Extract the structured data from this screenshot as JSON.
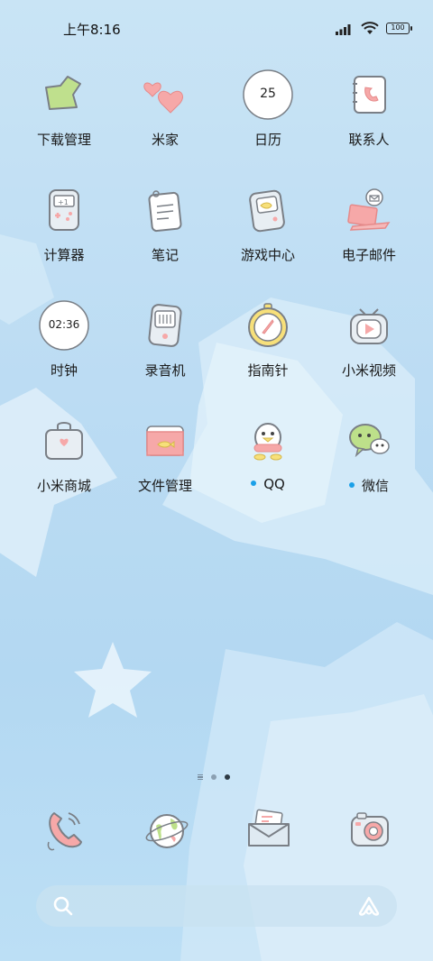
{
  "status_bar": {
    "time": "上午8:16",
    "battery_level": "100",
    "signal_icon": "signal-icon",
    "wifi_icon": "wifi-icon"
  },
  "apps": [
    {
      "label": "下载管理",
      "icon": "download-manager-icon",
      "badge_dot": false
    },
    {
      "label": "米家",
      "icon": "mijia-hearts-icon",
      "badge_dot": false
    },
    {
      "label": "日历",
      "icon": "calendar-icon",
      "date_number": "25",
      "badge_dot": false
    },
    {
      "label": "联系人",
      "icon": "contacts-icon",
      "badge_dot": false
    },
    {
      "label": "计算器",
      "icon": "calculator-icon",
      "badge_dot": false
    },
    {
      "label": "笔记",
      "icon": "notes-icon",
      "badge_dot": false
    },
    {
      "label": "游戏中心",
      "icon": "game-center-icon",
      "badge_dot": false
    },
    {
      "label": "电子邮件",
      "icon": "email-laptop-icon",
      "badge_dot": false
    },
    {
      "label": "时钟",
      "icon": "clock-icon",
      "clock_time": "02:36",
      "badge_dot": false
    },
    {
      "label": "录音机",
      "icon": "recorder-icon",
      "badge_dot": false
    },
    {
      "label": "指南针",
      "icon": "compass-icon",
      "badge_dot": false
    },
    {
      "label": "小米视频",
      "icon": "video-tv-icon",
      "badge_dot": false
    },
    {
      "label": "小米商城",
      "icon": "shopping-bag-icon",
      "badge_dot": false
    },
    {
      "label": "文件管理",
      "icon": "file-folder-icon",
      "badge_dot": false
    },
    {
      "label": "QQ",
      "icon": "qq-penguin-icon",
      "badge_dot": true
    },
    {
      "label": "微信",
      "icon": "wechat-icon",
      "badge_dot": true
    }
  ],
  "page_indicator": {
    "pages": 2,
    "active_index": 1
  },
  "dock": [
    {
      "icon": "phone-icon"
    },
    {
      "icon": "browser-globe-icon"
    },
    {
      "icon": "messages-envelope-icon"
    },
    {
      "icon": "camera-icon"
    }
  ],
  "search_bar": {
    "placeholder": "",
    "search_icon": "search-icon",
    "assistant_icon": "assistant-icon"
  },
  "colors": {
    "background_top": "#c9e4f5",
    "background_bottom": "#bcdff5",
    "badge_dot": "#1aa0e8",
    "icon_outline": "#7a7f86",
    "pink": "#f6a8a8",
    "yellow": "#f7e07a",
    "green": "#bde08a"
  }
}
